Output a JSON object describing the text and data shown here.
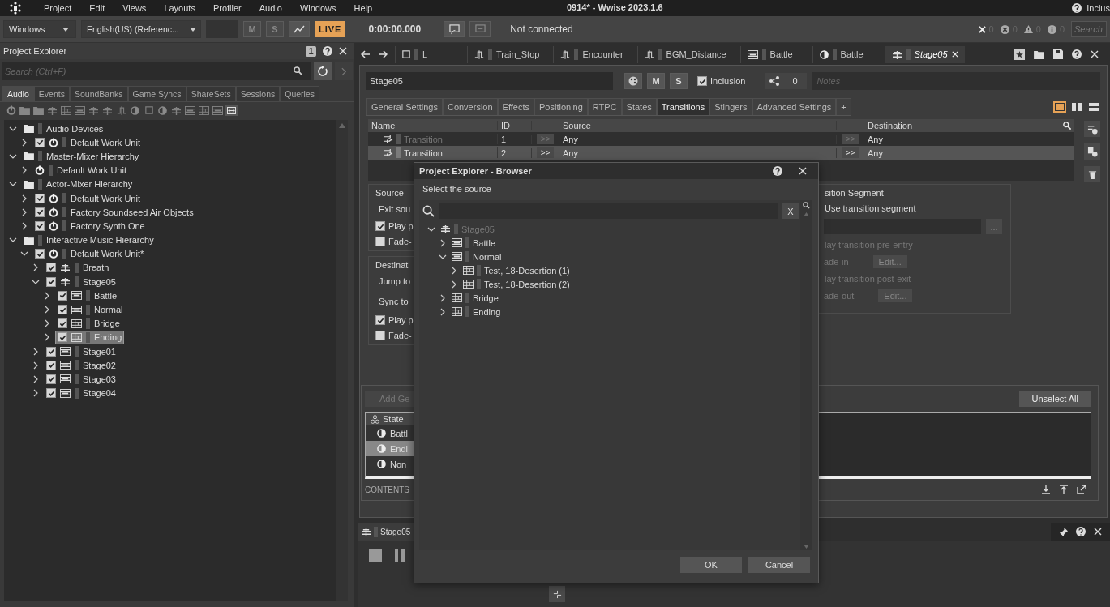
{
  "menu_bar": {
    "items": [
      "Project",
      "Edit",
      "Views",
      "Layouts",
      "Profiler",
      "Audio",
      "Windows",
      "Help"
    ],
    "title": "0914* - Wwise 2023.1.6",
    "right_label": "Inclus"
  },
  "toolbar": {
    "platform": "Windows",
    "language": "English(US) (Referenc...",
    "mute": "M",
    "solo": "S",
    "live": "LIVE",
    "live_on": true,
    "time": "0:00:00.000",
    "connection": "Not connected",
    "counters": [
      {
        "kind": "close",
        "count": "0"
      },
      {
        "kind": "error",
        "count": "0"
      },
      {
        "kind": "warning",
        "count": "0"
      },
      {
        "kind": "info",
        "count": "0"
      }
    ],
    "search": {
      "placeholder": "Search"
    }
  },
  "explorer": {
    "title": "Project Explorer",
    "badge": "1",
    "search": {
      "placeholder": "Search (Ctrl+F)"
    },
    "tabs": [
      {
        "label": "Audio",
        "selected": true
      },
      {
        "label": "Events",
        "selected": false
      },
      {
        "label": "SoundBanks",
        "selected": false
      },
      {
        "label": "Game Syncs",
        "selected": false
      },
      {
        "label": "ShareSets",
        "selected": false
      },
      {
        "label": "Sessions",
        "selected": false
      },
      {
        "label": "Queries",
        "selected": false
      }
    ],
    "tree": [
      {
        "label": "Audio Devices",
        "kind": "folder",
        "expanded": true,
        "selected": false,
        "children": [
          {
            "label": "Default Work Unit",
            "kind": "workunit",
            "checked": true,
            "expanded": false,
            "selected": false
          }
        ]
      },
      {
        "label": "Master-Mixer Hierarchy",
        "kind": "folder",
        "expanded": true,
        "selected": false,
        "children": [
          {
            "label": "Default Work Unit",
            "kind": "workunit",
            "expanded": false,
            "selected": false
          }
        ]
      },
      {
        "label": "Actor-Mixer Hierarchy",
        "kind": "folder",
        "expanded": true,
        "selected": false,
        "children": [
          {
            "label": "Default Work Unit",
            "kind": "workunit",
            "checked": true,
            "expanded": false,
            "selected": false
          },
          {
            "label": "Factory Soundseed Air Objects",
            "kind": "workunit",
            "checked": true,
            "expanded": false,
            "selected": false
          },
          {
            "label": "Factory Synth One",
            "kind": "workunit",
            "checked": true,
            "expanded": false,
            "selected": false
          }
        ]
      },
      {
        "label": "Interactive Music Hierarchy",
        "kind": "folder",
        "expanded": true,
        "selected": false,
        "children": [
          {
            "label": "Default Work Unit*",
            "kind": "workunit",
            "checked": true,
            "expanded": true,
            "selected": false,
            "children": [
              {
                "label": "Breath",
                "kind": "switch",
                "checked": true,
                "expanded": false,
                "selected": false
              },
              {
                "label": "Stage05",
                "kind": "switch",
                "checked": true,
                "expanded": true,
                "selected": false,
                "children": [
                  {
                    "label": "Battle",
                    "kind": "segment",
                    "checked": true,
                    "expanded": false,
                    "selected": false
                  },
                  {
                    "label": "Normal",
                    "kind": "segment",
                    "checked": true,
                    "expanded": false,
                    "selected": false
                  },
                  {
                    "label": "Bridge",
                    "kind": "playlist",
                    "checked": true,
                    "expanded": false,
                    "selected": false
                  },
                  {
                    "label": "Ending",
                    "kind": "playlist",
                    "checked": true,
                    "expanded": false,
                    "selected": true
                  }
                ]
              },
              {
                "label": "Stage01",
                "kind": "segment",
                "checked": true,
                "expanded": false,
                "selected": false
              },
              {
                "label": "Stage02",
                "kind": "segment",
                "checked": true,
                "expanded": false,
                "selected": false
              },
              {
                "label": "Stage03",
                "kind": "segment",
                "checked": true,
                "expanded": false,
                "selected": false
              },
              {
                "label": "Stage04",
                "kind": "segment",
                "checked": true,
                "expanded": false,
                "selected": false
              }
            ]
          }
        ]
      }
    ]
  },
  "editor_tabs": [
    {
      "label": "L",
      "kind": "sound",
      "selected": false
    },
    {
      "label": "Train_Stop",
      "kind": "rtpc",
      "selected": false
    },
    {
      "label": "Encounter",
      "kind": "rtpc",
      "selected": false
    },
    {
      "label": "BGM_Distance",
      "kind": "rtpc",
      "selected": false
    },
    {
      "label": "Battle",
      "kind": "segment",
      "selected": false
    },
    {
      "label": "Battle",
      "kind": "state",
      "selected": false
    },
    {
      "label": "Stage05",
      "kind": "switch",
      "selected": true
    }
  ],
  "property_editor": {
    "name": "Stage05",
    "mute": "M",
    "solo": "S",
    "inclusion": {
      "label": "Inclusion",
      "checked": true
    },
    "references": "0",
    "notes": {
      "placeholder": "Notes"
    },
    "tabs": [
      {
        "label": "General Settings",
        "selected": false
      },
      {
        "label": "Conversion",
        "selected": false
      },
      {
        "label": "Effects",
        "selected": false
      },
      {
        "label": "Positioning",
        "selected": false
      },
      {
        "label": "RTPC",
        "selected": false
      },
      {
        "label": "States",
        "selected": false
      },
      {
        "label": "Transitions",
        "selected": true
      },
      {
        "label": "Stingers",
        "selected": false
      },
      {
        "label": "Advanced Settings",
        "selected": false
      },
      {
        "label": "+",
        "selected": false
      }
    ],
    "columns": {
      "name": "Name",
      "id": "ID",
      "source": "Source",
      "destination": "Destination"
    },
    "transitions": [
      {
        "name": "Transition",
        "id": "1",
        "source_button": ">>",
        "source": "Any",
        "destination_button": ">>",
        "destination": "Any",
        "disabled": true,
        "selected": false
      },
      {
        "name": "Transition",
        "id": "2",
        "source_button": ">>",
        "source": "Any",
        "destination_button": ">>",
        "destination": "Any",
        "disabled": false,
        "selected": true
      }
    ],
    "source_group": {
      "legend": "Source",
      "exit_label": "Exit sou",
      "play": {
        "label": "Play p",
        "checked": true
      },
      "fade": {
        "label": "Fade-",
        "checked": false
      }
    },
    "destination_group": {
      "legend": "Destinati",
      "jump_label": "Jump to",
      "sync_label": "Sync to",
      "play": {
        "label": "Play p",
        "checked": true
      },
      "fade": {
        "label": "Fade-",
        "checked": false
      }
    },
    "segment_group": {
      "legend": "sition Segment",
      "use_label": "Use transition segment",
      "browse": "...",
      "pre_entry": "lay transition pre-entry",
      "fade_in": "ade-in",
      "fade_in_edit": "Edit...",
      "post_exit": "lay transition post-exit",
      "fade_out": "ade-out",
      "fade_out_edit": "Edit..."
    },
    "states_panel": {
      "add_button": "Add Ge",
      "unselect_button": "Unselect All",
      "header": "State",
      "rows": [
        {
          "label": "Battl",
          "selected": false
        },
        {
          "label": "Endi",
          "selected": true
        },
        {
          "label": "Non",
          "selected": false
        }
      ],
      "contents_label": "CONTENTS"
    }
  },
  "transport": {
    "title": "Stage05"
  },
  "dialog": {
    "title": "Project Explorer - Browser",
    "prompt": "Select the source",
    "clear_button": "X",
    "tree": [
      {
        "label": "Stage05",
        "kind": "switch",
        "expanded": true,
        "disabled": true,
        "children": [
          {
            "label": "Battle",
            "kind": "segment",
            "expanded": false,
            "disabled": false
          },
          {
            "label": "Normal",
            "kind": "segment",
            "expanded": true,
            "disabled": false,
            "children": [
              {
                "label": "Test, 18-Desertion (1)",
                "kind": "playlist",
                "expanded": false,
                "disabled": false
              },
              {
                "label": "Test, 18-Desertion (2)",
                "kind": "playlist",
                "expanded": false,
                "disabled": false
              }
            ]
          },
          {
            "label": "Bridge",
            "kind": "playlist",
            "expanded": false,
            "disabled": false
          },
          {
            "label": "Ending",
            "kind": "playlist",
            "expanded": false,
            "disabled": false
          }
        ]
      }
    ],
    "ok": "OK",
    "cancel": "Cancel"
  }
}
